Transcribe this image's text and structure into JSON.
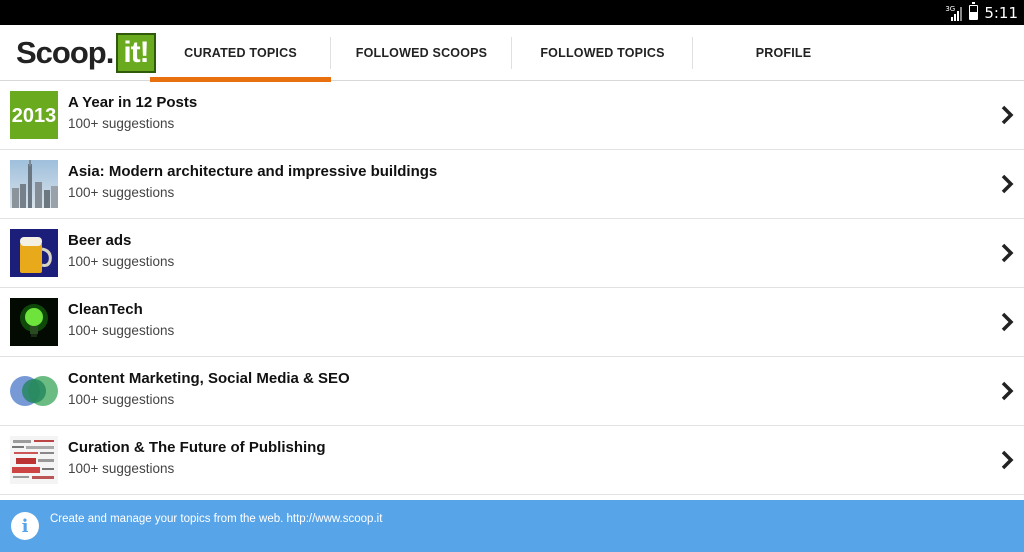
{
  "status_bar": {
    "network": "3G",
    "time": "5:11"
  },
  "header": {
    "logo_text": "Scoop.",
    "logo_badge": "it!",
    "tabs": [
      {
        "label": "CURATED TOPICS",
        "active": true
      },
      {
        "label": "FOLLOWED SCOOPS",
        "active": false
      },
      {
        "label": "FOLLOWED TOPICS",
        "active": false
      },
      {
        "label": "PROFILE",
        "active": false
      }
    ]
  },
  "topics": [
    {
      "title": "A Year in 12 Posts",
      "subtitle": "100+ suggestions",
      "thumb_label": "2013"
    },
    {
      "title": "Asia: Modern architecture and impressive buildings",
      "subtitle": "100+ suggestions"
    },
    {
      "title": "Beer ads",
      "subtitle": "100+ suggestions"
    },
    {
      "title": "CleanTech",
      "subtitle": "100+ suggestions"
    },
    {
      "title": "Content Marketing, Social Media & SEO",
      "subtitle": "100+ suggestions"
    },
    {
      "title": "Curation & The Future of Publishing",
      "subtitle": "100+ suggestions"
    }
  ],
  "banner": {
    "icon": "info-icon",
    "text": "Create and manage your topics from the web. http://www.scoop.it"
  },
  "colors": {
    "accent": "#e8700f",
    "brand_green": "#6aaa1e",
    "banner": "#58a4e8"
  }
}
